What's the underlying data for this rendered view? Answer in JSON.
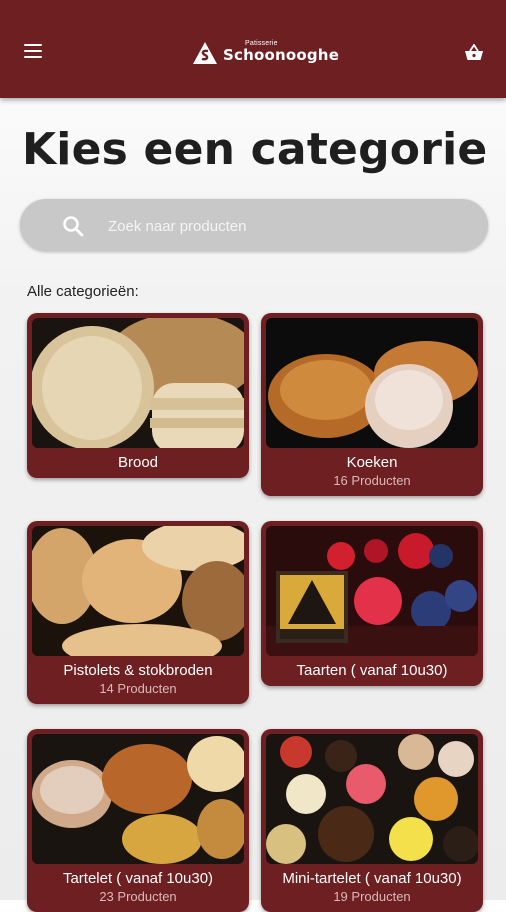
{
  "header": {
    "logo_small": "Patisserie",
    "logo_big": "Schoonooghe",
    "brand_color": "#6e1f22",
    "menu_icon": "hamburger-menu-icon",
    "cart_icon": "shopping-basket-icon"
  },
  "page": {
    "title": "Kies een categorie"
  },
  "search": {
    "placeholder": "Zoek naar producten",
    "icon": "search-icon"
  },
  "categories_label": "Alle categorieën:",
  "categories": [
    {
      "name": "Brood",
      "count": ""
    },
    {
      "name": "Koeken",
      "count": "16 Producten"
    },
    {
      "name": "Pistolets & stokbroden",
      "count": "14 Producten"
    },
    {
      "name": "Taarten ( vanaf 10u30)",
      "count": ""
    },
    {
      "name": "Tartelet ( vanaf 10u30)",
      "count": "23 Producten"
    },
    {
      "name": "Mini-tartelet ( vanaf 10u30)",
      "count": "19 Producten"
    }
  ]
}
